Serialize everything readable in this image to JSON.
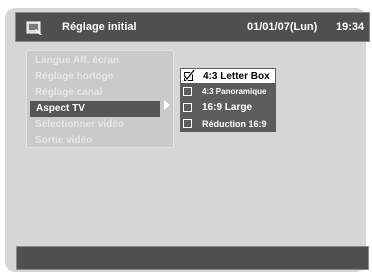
{
  "header": {
    "title": "Réglage initial",
    "date": "01/01/07(Lun)",
    "time": "19:34",
    "icon": "setup-icon"
  },
  "menu": {
    "items": [
      {
        "label": "Langue Aff. écran",
        "state": "dimmed"
      },
      {
        "label": "Réglage horloge",
        "state": "dimmed"
      },
      {
        "label": "Réglage canal",
        "state": "dimmed"
      },
      {
        "label": "Aspect TV",
        "state": "selected"
      },
      {
        "label": "Sélectionner vidéo",
        "state": "dimmed"
      },
      {
        "label": "Sortie vidéo",
        "state": "dimmed"
      }
    ]
  },
  "options": {
    "items": [
      {
        "label": "4:3 Letter Box",
        "checked": true,
        "highlighted": true
      },
      {
        "label": "4:3 Panoramique",
        "checked": false,
        "highlighted": false
      },
      {
        "label": "16:9 Large",
        "checked": false,
        "highlighted": false
      },
      {
        "label": "Réduction 16:9",
        "checked": false,
        "highlighted": false
      }
    ]
  },
  "colors": {
    "bar": "#4f4f4f",
    "panel": "#cacaca",
    "background": "#d6d6d6",
    "selected": "#555555",
    "option_bg": "#5c5c5c"
  }
}
